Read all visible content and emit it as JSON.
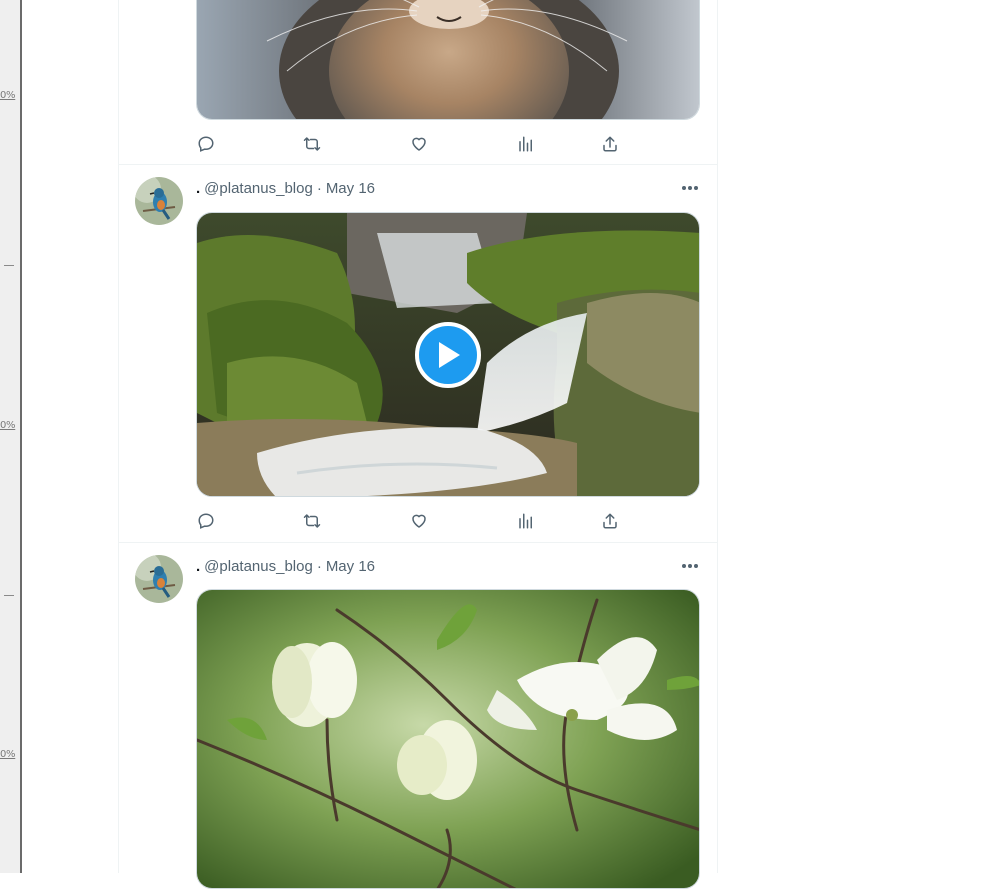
{
  "ruler": {
    "marks": [
      "0%",
      "0%",
      "0%"
    ]
  },
  "posts": [
    {
      "id": "post-cat",
      "image_alt": "Close-up photo of a cat's chin and whiskers"
    },
    {
      "id": "post-waterfall",
      "author_dot": ".",
      "handle": "@platanus_blog",
      "sep": "·",
      "date": "May 16",
      "media_type": "video",
      "image_alt": "Waterfall flowing between mossy rocks"
    },
    {
      "id": "post-dogwood",
      "author_dot": ".",
      "handle": "@platanus_blog",
      "sep": "·",
      "date": "May 16",
      "media_type": "photo",
      "image_alt": "White dogwood flowers on branches"
    }
  ],
  "icons": {
    "reply": "reply-icon",
    "repost": "repost-icon",
    "like": "like-icon",
    "views": "views-icon",
    "share": "share-icon",
    "more": "more-icon",
    "play": "play-icon"
  },
  "colors": {
    "accent": "#1d9bf0",
    "icon": "#536471",
    "border": "#eff3f4"
  }
}
